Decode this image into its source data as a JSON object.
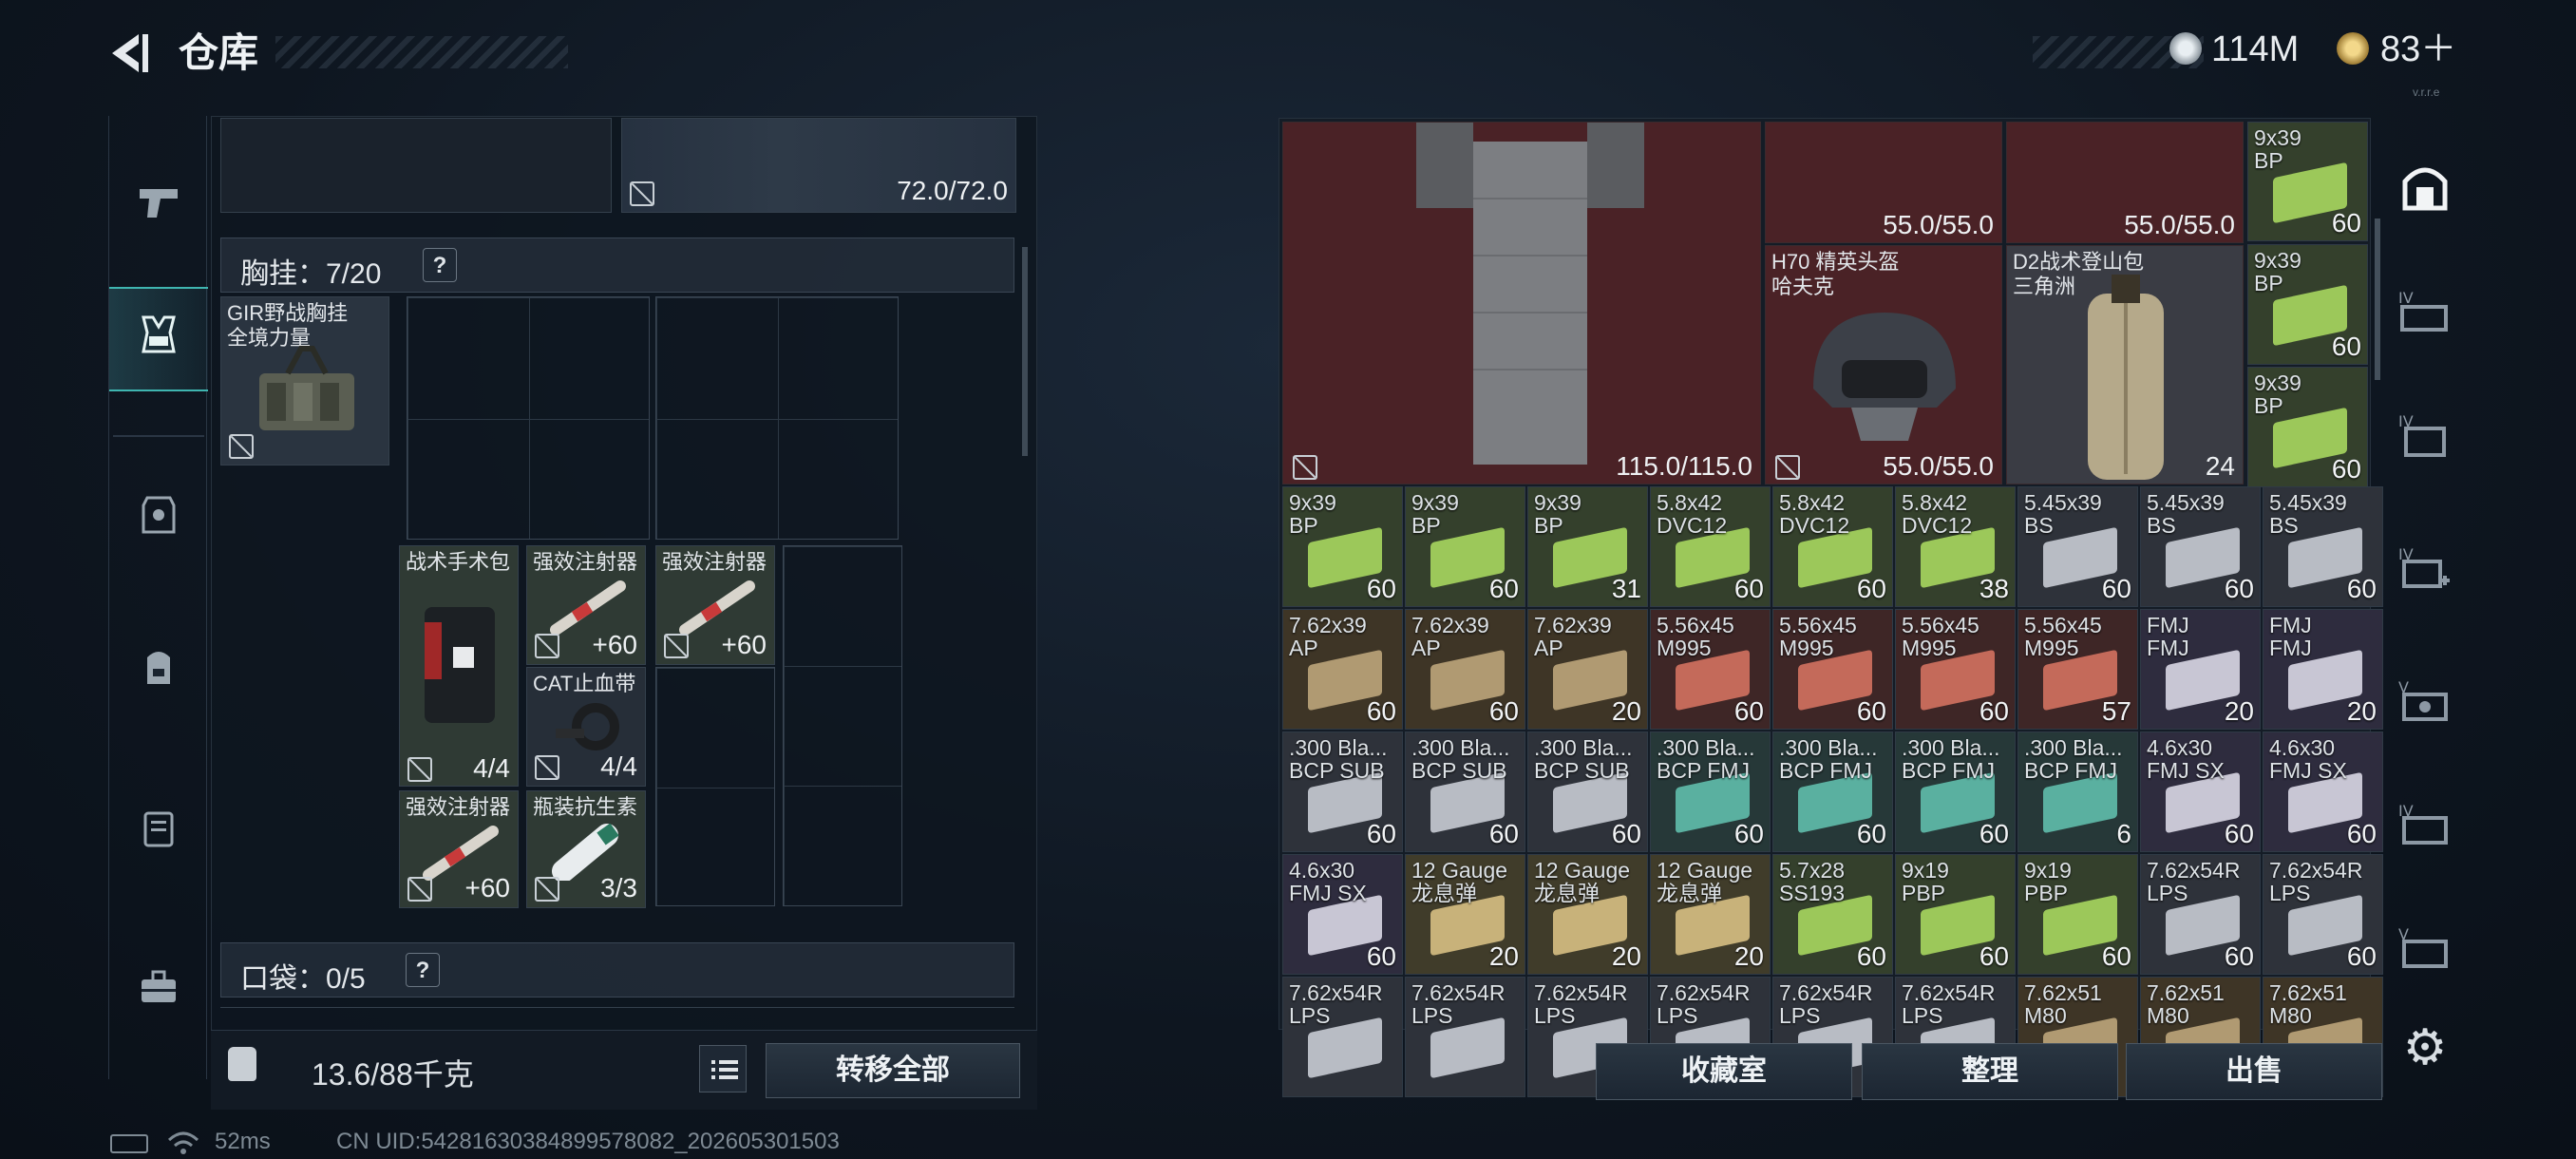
{
  "header": {
    "title": "仓库",
    "currency1": "114M",
    "currency2": "83＋",
    "version_label": "v.r.r.e"
  },
  "sidenav": [
    {
      "icon": "pistol-icon"
    },
    {
      "icon": "chest-rig-icon",
      "active": true
    },
    {
      "icon": "armor-icon"
    },
    {
      "icon": "backpack-icon"
    },
    {
      "icon": "case-icon"
    },
    {
      "icon": "toolbox-icon"
    }
  ],
  "left": {
    "top_item_durability": "72.0/72.0",
    "chest_rig_title": "胸挂：7/20",
    "chest_rig_item": "GIR野战胸挂\n全境力量",
    "items": {
      "kit": {
        "name": "战术手术包",
        "count": "4/4"
      },
      "inj1": {
        "name": "强效注射器",
        "count": "+60"
      },
      "inj2": {
        "name": "强效注射器",
        "count": "+60"
      },
      "tourniquet": {
        "name": "CAT止血带",
        "count": "4/4"
      },
      "inj3": {
        "name": "强效注射器",
        "count": "+60"
      },
      "antibiotic": {
        "name": "瓶装抗生素",
        "count": "3/3"
      }
    },
    "pocket_title": "口袋：0/5",
    "weight": "13.6/88千克",
    "move_all": "转移全部"
  },
  "right": {
    "armor_durability": "115.0/115.0",
    "helmet_top1": "55.0/55.0",
    "helmet_top2": "55.0/55.0",
    "helmet": {
      "name": "H70 精英头盔\n哈夫克",
      "durability": "55.0/55.0"
    },
    "backpack": {
      "name": "D2战术登山包\n三角洲",
      "count": "24"
    },
    "side_ammo": [
      {
        "name": "9x39\nBP",
        "count": "60"
      },
      {
        "name": "9x39\nBP",
        "count": "60"
      },
      {
        "name": "9x39\nBP",
        "count": "60"
      }
    ],
    "grid": [
      [
        {
          "n": "9x39\nBP",
          "c": "60",
          "t": "green"
        },
        {
          "n": "9x39\nBP",
          "c": "60",
          "t": "green"
        },
        {
          "n": "9x39\nBP",
          "c": "31",
          "t": "green"
        },
        {
          "n": "5.8x42\nDVC12",
          "c": "60",
          "t": "green"
        },
        {
          "n": "5.8x42\nDVC12",
          "c": "60",
          "t": "green"
        },
        {
          "n": "5.8x42\nDVC12",
          "c": "38",
          "t": "green"
        },
        {
          "n": "5.45x39\nBS",
          "c": "60",
          "t": "grey"
        },
        {
          "n": "5.45x39\nBS",
          "c": "60",
          "t": "grey"
        },
        {
          "n": "5.45x39\nBS",
          "c": "60",
          "t": "grey"
        }
      ],
      [
        {
          "n": "7.62x39\nAP",
          "c": "60",
          "t": "brown"
        },
        {
          "n": "7.62x39\nAP",
          "c": "60",
          "t": "brown"
        },
        {
          "n": "7.62x39\nAP",
          "c": "20",
          "t": "brown"
        },
        {
          "n": "5.56x45\nM995",
          "c": "60",
          "t": "red"
        },
        {
          "n": "5.56x45\nM995",
          "c": "60",
          "t": "red"
        },
        {
          "n": "5.56x45\nM995",
          "c": "60",
          "t": "red"
        },
        {
          "n": "5.56x45\nM995",
          "c": "57",
          "t": "red"
        },
        {
          "n": "FMJ\nFMJ",
          "c": "20",
          "t": "purple"
        },
        {
          "n": "FMJ\nFMJ",
          "c": "20",
          "t": "purple"
        }
      ],
      [
        {
          "n": ".300 Bla...\nBCP SUB",
          "c": "60",
          "t": "grey"
        },
        {
          "n": ".300 Bla...\nBCP SUB",
          "c": "60",
          "t": "grey"
        },
        {
          "n": ".300 Bla...\nBCP SUB",
          "c": "60",
          "t": "grey"
        },
        {
          "n": ".300 Bla...\nBCP FMJ",
          "c": "60",
          "t": "teal"
        },
        {
          "n": ".300 Bla...\nBCP FMJ",
          "c": "60",
          "t": "teal"
        },
        {
          "n": ".300 Bla...\nBCP FMJ",
          "c": "60",
          "t": "teal"
        },
        {
          "n": ".300 Bla...\nBCP FMJ",
          "c": "6",
          "t": "teal"
        },
        {
          "n": "4.6x30\nFMJ SX",
          "c": "60",
          "t": "purple"
        },
        {
          "n": "4.6x30\nFMJ SX",
          "c": "60",
          "t": "purple"
        }
      ],
      [
        {
          "n": "4.6x30\nFMJ SX",
          "c": "60",
          "t": "purple"
        },
        {
          "n": "12 Gauge\n龙息弹",
          "c": "20",
          "t": "tan"
        },
        {
          "n": "12 Gauge\n龙息弹",
          "c": "20",
          "t": "tan"
        },
        {
          "n": "12 Gauge\n龙息弹",
          "c": "20",
          "t": "tan"
        },
        {
          "n": "5.7x28\nSS193",
          "c": "60",
          "t": "green"
        },
        {
          "n": "9x19\nPBP",
          "c": "60",
          "t": "green"
        },
        {
          "n": "9x19\nPBP",
          "c": "60",
          "t": "green"
        },
        {
          "n": "7.62x54R\nLPS",
          "c": "60",
          "t": "grey"
        },
        {
          "n": "7.62x54R\nLPS",
          "c": "60",
          "t": "grey"
        }
      ],
      [
        {
          "n": "7.62x54R\nLPS",
          "c": "",
          "t": "grey"
        },
        {
          "n": "7.62x54R\nLPS",
          "c": "",
          "t": "grey"
        },
        {
          "n": "7.62x54R\nLPS",
          "c": "",
          "t": "grey"
        },
        {
          "n": "7.62x54R\nLPS",
          "c": "",
          "t": "grey"
        },
        {
          "n": "7.62x54R\nLPS",
          "c": "",
          "t": "grey"
        },
        {
          "n": "7.62x54R\nLPS",
          "c": "",
          "t": "grey"
        },
        {
          "n": "7.62x51\nM80",
          "c": "",
          "t": "brown"
        },
        {
          "n": "7.62x51\nM80",
          "c": "",
          "t": "brown"
        },
        {
          "n": "7.62x51\nM80",
          "c": "",
          "t": "brown"
        }
      ]
    ],
    "buttons": {
      "collection": "收藏室",
      "organize": "整理",
      "sell": "出售"
    }
  },
  "rightnav": [
    {
      "icon": "safebox-icon",
      "active": true
    },
    {
      "icon": "storage-iv-1-icon"
    },
    {
      "icon": "storage-iv-2-icon"
    },
    {
      "icon": "storage-iv-3-icon"
    },
    {
      "icon": "storage-v-1-icon"
    },
    {
      "icon": "storage-iv-4-icon"
    },
    {
      "icon": "storage-v-2-icon"
    }
  ],
  "status": {
    "ping": "52ms",
    "uid": "CN UID:54281630384899578082_202605301503"
  }
}
